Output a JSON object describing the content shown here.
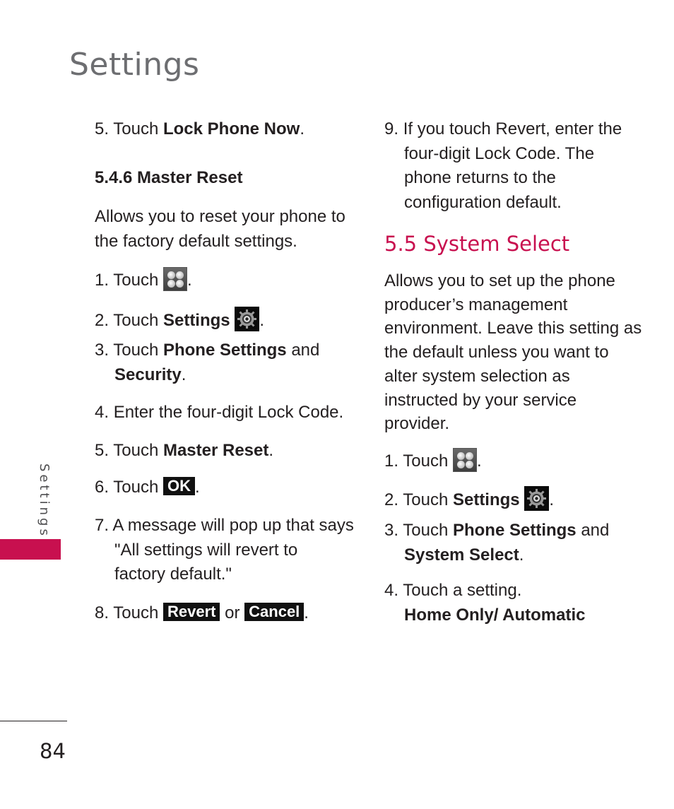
{
  "page": {
    "title": "Settings",
    "side_tab_label": "Settings",
    "page_number": "84",
    "accent_color": "#c8104f"
  },
  "left_column": {
    "step5_prev": {
      "num": "5.",
      "prefix": "Touch ",
      "bold": "Lock Phone Now",
      "suffix": "."
    },
    "sub_heading": "5.4.6 Master Reset",
    "intro": "Allows you to reset your phone to the factory default settings.",
    "steps": [
      {
        "num": "1.",
        "prefix": "Touch ",
        "icon": "menu-grid-icon",
        "suffix": "."
      },
      {
        "num": "2.",
        "prefix": "Touch ",
        "bold": "Settings",
        "icon": "settings-gear-icon",
        "suffix": "."
      },
      {
        "num": "3.",
        "prefix": "Touch ",
        "bold": "Phone Settings",
        "mid": " and",
        "bold2": "Security",
        "suffix": "."
      },
      {
        "num": "4.",
        "text": "Enter the four-digit Lock Code."
      },
      {
        "num": "5.",
        "prefix": "Touch ",
        "bold": "Master Reset",
        "suffix": "."
      },
      {
        "num": "6.",
        "prefix": "Touch ",
        "key": "OK",
        "suffix": "."
      },
      {
        "num": "7.",
        "line1": "A message will pop up that says",
        "line2": "\"All settings will revert to",
        "line3": "factory default.\""
      },
      {
        "num": "8.",
        "prefix": "Touch ",
        "key": "Revert",
        "mid": " or ",
        "key2": "Cancel",
        "suffix": "."
      }
    ]
  },
  "right_column": {
    "step9": {
      "num": "9.",
      "lines": [
        "If you touch Revert, enter the",
        "four-digit Lock Code. The",
        "phone returns to the",
        "configuration default."
      ]
    },
    "section_heading": "5.5 System Select",
    "intro_lines": [
      "Allows you to set up the phone",
      "producer’s management",
      "environment. Leave this setting as",
      "the default unless you want to",
      "alter system selection as",
      "instructed by your service",
      "provider."
    ],
    "steps": [
      {
        "num": "1.",
        "prefix": "Touch ",
        "icon": "menu-grid-icon",
        "suffix": "."
      },
      {
        "num": "2.",
        "prefix": "Touch ",
        "bold": "Settings",
        "icon": "settings-gear-icon",
        "suffix": "."
      },
      {
        "num": "3.",
        "prefix": "Touch ",
        "bold": "Phone Settings",
        "mid": " and",
        "bold2": "System Select",
        "suffix": "."
      },
      {
        "num": "4.",
        "text": "Touch a setting.",
        "bold_line": "Home Only/ Automatic"
      }
    ]
  }
}
